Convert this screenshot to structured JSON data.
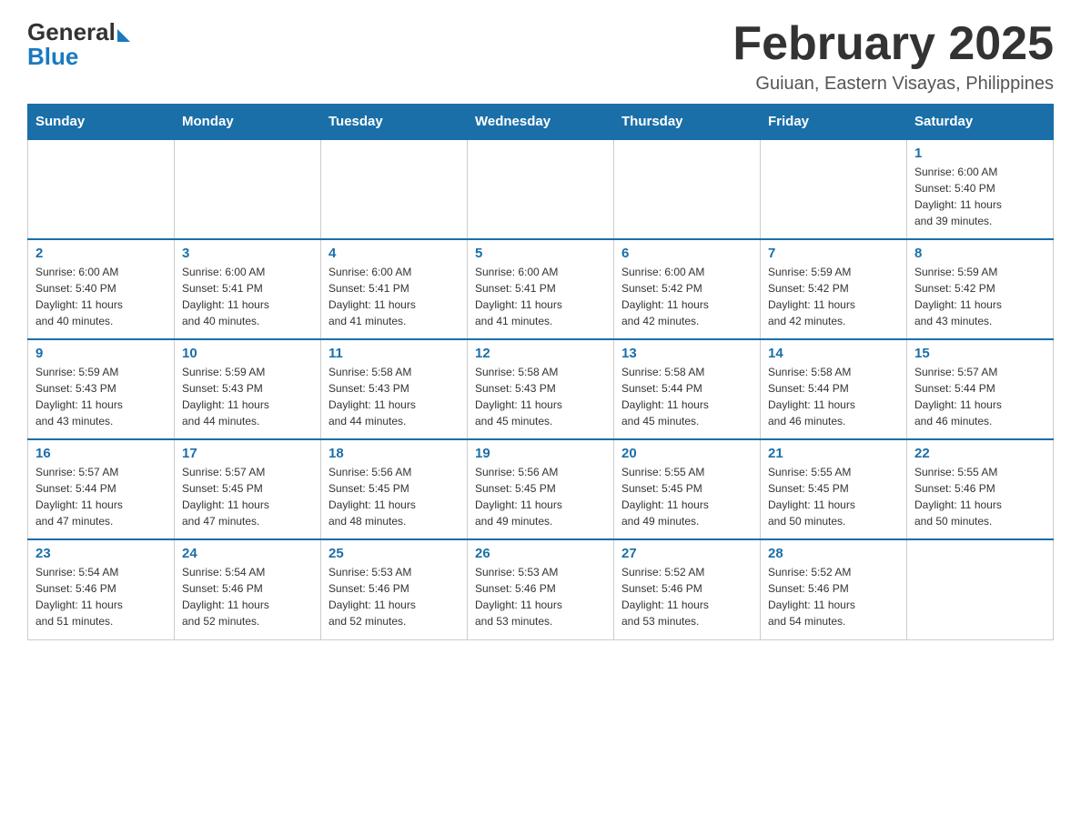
{
  "header": {
    "logo_general": "General",
    "logo_blue": "Blue",
    "month_title": "February 2025",
    "location": "Guiuan, Eastern Visayas, Philippines"
  },
  "weekdays": [
    "Sunday",
    "Monday",
    "Tuesday",
    "Wednesday",
    "Thursday",
    "Friday",
    "Saturday"
  ],
  "weeks": [
    [
      {
        "day": "",
        "info": ""
      },
      {
        "day": "",
        "info": ""
      },
      {
        "day": "",
        "info": ""
      },
      {
        "day": "",
        "info": ""
      },
      {
        "day": "",
        "info": ""
      },
      {
        "day": "",
        "info": ""
      },
      {
        "day": "1",
        "info": "Sunrise: 6:00 AM\nSunset: 5:40 PM\nDaylight: 11 hours\nand 39 minutes."
      }
    ],
    [
      {
        "day": "2",
        "info": "Sunrise: 6:00 AM\nSunset: 5:40 PM\nDaylight: 11 hours\nand 40 minutes."
      },
      {
        "day": "3",
        "info": "Sunrise: 6:00 AM\nSunset: 5:41 PM\nDaylight: 11 hours\nand 40 minutes."
      },
      {
        "day": "4",
        "info": "Sunrise: 6:00 AM\nSunset: 5:41 PM\nDaylight: 11 hours\nand 41 minutes."
      },
      {
        "day": "5",
        "info": "Sunrise: 6:00 AM\nSunset: 5:41 PM\nDaylight: 11 hours\nand 41 minutes."
      },
      {
        "day": "6",
        "info": "Sunrise: 6:00 AM\nSunset: 5:42 PM\nDaylight: 11 hours\nand 42 minutes."
      },
      {
        "day": "7",
        "info": "Sunrise: 5:59 AM\nSunset: 5:42 PM\nDaylight: 11 hours\nand 42 minutes."
      },
      {
        "day": "8",
        "info": "Sunrise: 5:59 AM\nSunset: 5:42 PM\nDaylight: 11 hours\nand 43 minutes."
      }
    ],
    [
      {
        "day": "9",
        "info": "Sunrise: 5:59 AM\nSunset: 5:43 PM\nDaylight: 11 hours\nand 43 minutes."
      },
      {
        "day": "10",
        "info": "Sunrise: 5:59 AM\nSunset: 5:43 PM\nDaylight: 11 hours\nand 44 minutes."
      },
      {
        "day": "11",
        "info": "Sunrise: 5:58 AM\nSunset: 5:43 PM\nDaylight: 11 hours\nand 44 minutes."
      },
      {
        "day": "12",
        "info": "Sunrise: 5:58 AM\nSunset: 5:43 PM\nDaylight: 11 hours\nand 45 minutes."
      },
      {
        "day": "13",
        "info": "Sunrise: 5:58 AM\nSunset: 5:44 PM\nDaylight: 11 hours\nand 45 minutes."
      },
      {
        "day": "14",
        "info": "Sunrise: 5:58 AM\nSunset: 5:44 PM\nDaylight: 11 hours\nand 46 minutes."
      },
      {
        "day": "15",
        "info": "Sunrise: 5:57 AM\nSunset: 5:44 PM\nDaylight: 11 hours\nand 46 minutes."
      }
    ],
    [
      {
        "day": "16",
        "info": "Sunrise: 5:57 AM\nSunset: 5:44 PM\nDaylight: 11 hours\nand 47 minutes."
      },
      {
        "day": "17",
        "info": "Sunrise: 5:57 AM\nSunset: 5:45 PM\nDaylight: 11 hours\nand 47 minutes."
      },
      {
        "day": "18",
        "info": "Sunrise: 5:56 AM\nSunset: 5:45 PM\nDaylight: 11 hours\nand 48 minutes."
      },
      {
        "day": "19",
        "info": "Sunrise: 5:56 AM\nSunset: 5:45 PM\nDaylight: 11 hours\nand 49 minutes."
      },
      {
        "day": "20",
        "info": "Sunrise: 5:55 AM\nSunset: 5:45 PM\nDaylight: 11 hours\nand 49 minutes."
      },
      {
        "day": "21",
        "info": "Sunrise: 5:55 AM\nSunset: 5:45 PM\nDaylight: 11 hours\nand 50 minutes."
      },
      {
        "day": "22",
        "info": "Sunrise: 5:55 AM\nSunset: 5:46 PM\nDaylight: 11 hours\nand 50 minutes."
      }
    ],
    [
      {
        "day": "23",
        "info": "Sunrise: 5:54 AM\nSunset: 5:46 PM\nDaylight: 11 hours\nand 51 minutes."
      },
      {
        "day": "24",
        "info": "Sunrise: 5:54 AM\nSunset: 5:46 PM\nDaylight: 11 hours\nand 52 minutes."
      },
      {
        "day": "25",
        "info": "Sunrise: 5:53 AM\nSunset: 5:46 PM\nDaylight: 11 hours\nand 52 minutes."
      },
      {
        "day": "26",
        "info": "Sunrise: 5:53 AM\nSunset: 5:46 PM\nDaylight: 11 hours\nand 53 minutes."
      },
      {
        "day": "27",
        "info": "Sunrise: 5:52 AM\nSunset: 5:46 PM\nDaylight: 11 hours\nand 53 minutes."
      },
      {
        "day": "28",
        "info": "Sunrise: 5:52 AM\nSunset: 5:46 PM\nDaylight: 11 hours\nand 54 minutes."
      },
      {
        "day": "",
        "info": ""
      }
    ]
  ]
}
